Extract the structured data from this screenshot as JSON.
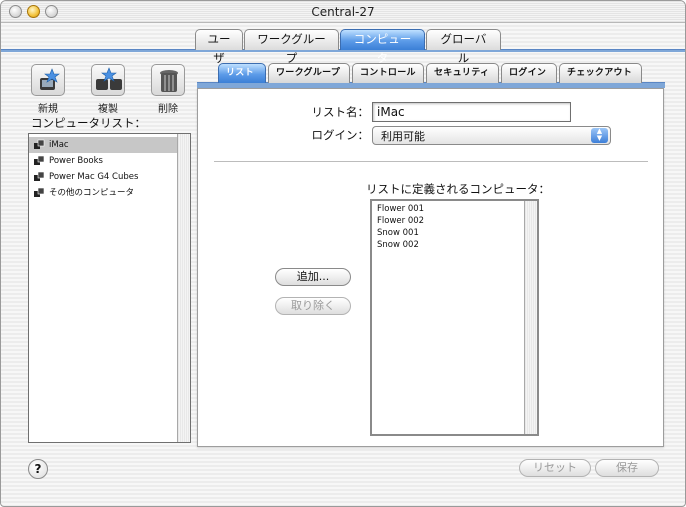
{
  "window": {
    "title": "Central-27"
  },
  "top_tabs": [
    {
      "label": "ユーザ"
    },
    {
      "label": "ワークグループ"
    },
    {
      "label": "コンピュータ"
    },
    {
      "label": "グローバル"
    }
  ],
  "toolbar": {
    "new_label": "新規",
    "duplicate_label": "複製",
    "delete_label": "削除"
  },
  "sidebar": {
    "heading": "コンピュータリスト：",
    "items": [
      {
        "label": "iMac"
      },
      {
        "label": "Power Books"
      },
      {
        "label": "Power Mac G4 Cubes"
      },
      {
        "label": "その他のコンピュータ"
      }
    ]
  },
  "sub_tabs": [
    {
      "label": "リスト"
    },
    {
      "label": "ワークグループ"
    },
    {
      "label": "コントロール"
    },
    {
      "label": "セキュリティ"
    },
    {
      "label": "ログイン"
    },
    {
      "label": "チェックアウト"
    }
  ],
  "form": {
    "list_name_label": "リスト名：",
    "list_name_value": "iMac",
    "login_label": "ログイン：",
    "login_value": "利用可能",
    "defined_label": "リストに定義されるコンピュータ：",
    "computers": [
      "Flower 001",
      "Flower 002",
      "Snow 001",
      "Snow 002"
    ],
    "add_button": "追加...",
    "remove_button": "取り除く"
  },
  "footer": {
    "help_label": "?",
    "reset_button": "リセット",
    "save_button": "保存"
  }
}
